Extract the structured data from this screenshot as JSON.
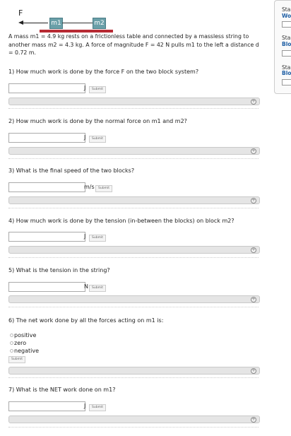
{
  "diagram": {
    "force_label": "F",
    "m1": "m1",
    "m2": "m2"
  },
  "intro": "A mass m1 = 4.9 kg rests on a frictionless table and connected by a massless string to another mass m2 = 4.3 kg. A force of magnitude F = 42 N pulls m1 to the left a distance d = 0.72 m.",
  "submit_label": "Submit",
  "questions": [
    {
      "text": "1) How much work is done by the force F on the two block system?",
      "unit": "J"
    },
    {
      "text": "2) How much work is done by the normal force on m1 and m2?",
      "unit": "J"
    },
    {
      "text": "3) What is the final speed of the two blocks?",
      "unit": "m/s"
    },
    {
      "text": "4) How much work is done by the tension (in-between the blocks) on block m2?",
      "unit": "J"
    },
    {
      "text": "5) What is the tension in the string?",
      "unit": "N"
    },
    {
      "text": "6) The net work done by all the forces acting on m1 is:",
      "options": [
        "positive",
        "zero",
        "negative"
      ]
    },
    {
      "text": "7) What is the NET work done on m1?",
      "unit": "J"
    }
  ],
  "sidebar": {
    "items": [
      {
        "title": "Sta",
        "subtitle": "Wo"
      },
      {
        "title": "Sta",
        "subtitle": "Blo"
      },
      {
        "title": "Sta",
        "subtitle": "Blo"
      }
    ]
  }
}
